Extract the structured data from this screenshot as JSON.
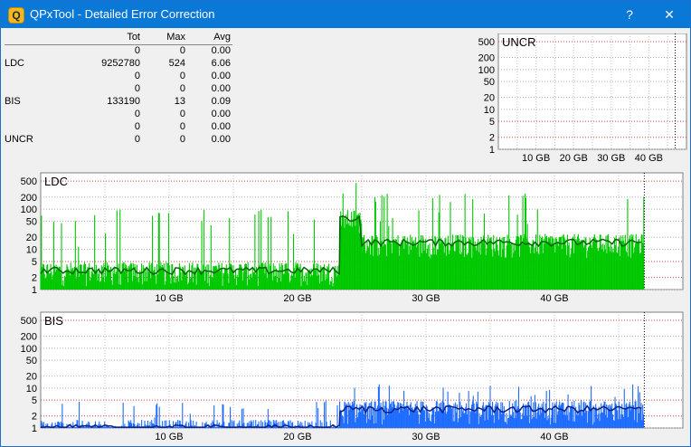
{
  "window": {
    "title": "QPxTool - Detailed Error Correction",
    "help_label": "?",
    "close_label": "✕",
    "app_icon_letter": "Q"
  },
  "stats": {
    "headers": [
      "",
      "Tot",
      "Max",
      "Avg"
    ],
    "rows": [
      {
        "label": "",
        "tot": "0",
        "max": "0",
        "avg": "0.00"
      },
      {
        "label": "LDC",
        "tot": "9252780",
        "max": "524",
        "avg": "6.06"
      },
      {
        "label": "",
        "tot": "0",
        "max": "0",
        "avg": "0.00"
      },
      {
        "label": "",
        "tot": "0",
        "max": "0",
        "avg": "0.00"
      },
      {
        "label": "BIS",
        "tot": "133190",
        "max": "13",
        "avg": "0.09"
      },
      {
        "label": "",
        "tot": "0",
        "max": "0",
        "avg": "0.00"
      },
      {
        "label": "",
        "tot": "0",
        "max": "0",
        "avg": "0.00"
      },
      {
        "label": "UNCR",
        "tot": "0",
        "max": "0",
        "avg": "0.00"
      }
    ]
  },
  "chart_data": [
    {
      "type": "bar",
      "title": "UNCR",
      "y_ticks": [
        "500",
        "200",
        "100",
        "50",
        "20",
        "10",
        "5",
        "2",
        "1"
      ],
      "x_ticks": [
        "10 GB",
        "20 GB",
        "30 GB",
        "40 GB"
      ],
      "x_range_gb": [
        0,
        50
      ],
      "y_scale": "log",
      "end_marker_gb": 47,
      "values": []
    },
    {
      "type": "bar",
      "title": "LDC",
      "y_ticks": [
        "500",
        "200",
        "100",
        "50",
        "20",
        "10",
        "5",
        "2",
        "1"
      ],
      "x_ticks": [
        "10 GB",
        "20 GB",
        "30 GB",
        "40 GB"
      ],
      "x_range_gb": [
        0,
        50
      ],
      "y_scale": "log",
      "end_marker_gb": 47,
      "max": 524,
      "color": "#00c800",
      "dark_color": "#006400",
      "segments": [
        {
          "from_gb": 0,
          "to_gb": 23.3,
          "typical": 3,
          "peak": 100
        },
        {
          "from_gb": 23.3,
          "to_gb": 25,
          "typical": 60,
          "peak": 524
        },
        {
          "from_gb": 25,
          "to_gb": 47,
          "typical": 15,
          "peak": 250
        }
      ]
    },
    {
      "type": "bar",
      "title": "BIS",
      "y_ticks": [
        "500",
        "200",
        "100",
        "50",
        "20",
        "10",
        "5",
        "2",
        "1"
      ],
      "x_ticks": [
        "10 GB",
        "20 GB",
        "30 GB",
        "40 GB"
      ],
      "x_range_gb": [
        0,
        50
      ],
      "y_scale": "log",
      "end_marker_gb": 47,
      "max": 13,
      "color": "#1e6cff",
      "dark_color": "#0a1e8c",
      "segments": [
        {
          "from_gb": 0,
          "to_gb": 23.3,
          "typical": 1,
          "peak": 5
        },
        {
          "from_gb": 23.3,
          "to_gb": 47,
          "typical": 3,
          "peak": 13
        }
      ]
    }
  ]
}
